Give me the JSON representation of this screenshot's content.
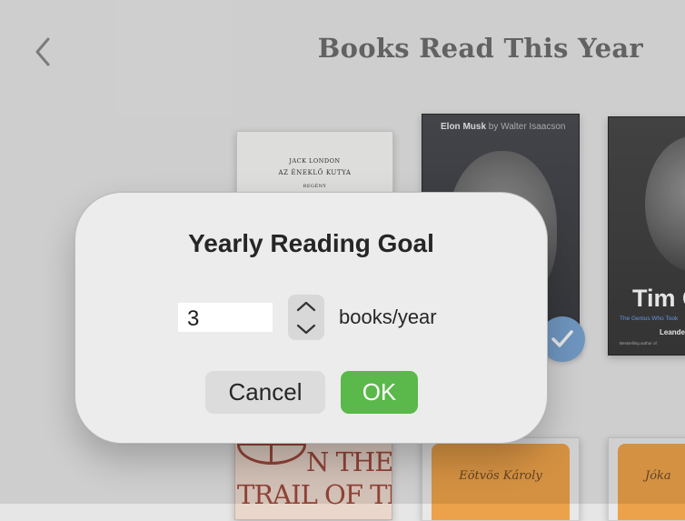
{
  "header": {
    "back_icon": "chevron-left-icon",
    "title": "Books Read This Year"
  },
  "books": [
    {
      "id": "london",
      "lines": [
        "JACK LONDON",
        "AZ ÉNEKLŐ KUTYA",
        "REGÉNY"
      ]
    },
    {
      "id": "musk",
      "title": "Elon Musk",
      "by": "by Walter Isaacson",
      "read": true
    },
    {
      "id": "cook",
      "title": "Tim C",
      "subtitle": "The Genius Who Took",
      "author": "Leande",
      "note": "Bestselling author of"
    },
    {
      "id": "trail",
      "line1": "N THE",
      "line2": "TRAIL OF THE"
    },
    {
      "id": "eotvos",
      "author": "Eötvös Károly"
    },
    {
      "id": "jokai",
      "author": "Jóka"
    }
  ],
  "dialog": {
    "title": "Yearly Reading Goal",
    "goal_value": "3",
    "unit_label": "books/year",
    "stepper_up_icon": "chevron-up-icon",
    "stepper_down_icon": "chevron-down-icon",
    "cancel_label": "Cancel",
    "ok_label": "OK"
  },
  "colors": {
    "ok_button": "#5bb84a",
    "check_badge": "#7ba6d4",
    "title_gray": "#6e6e6e"
  }
}
